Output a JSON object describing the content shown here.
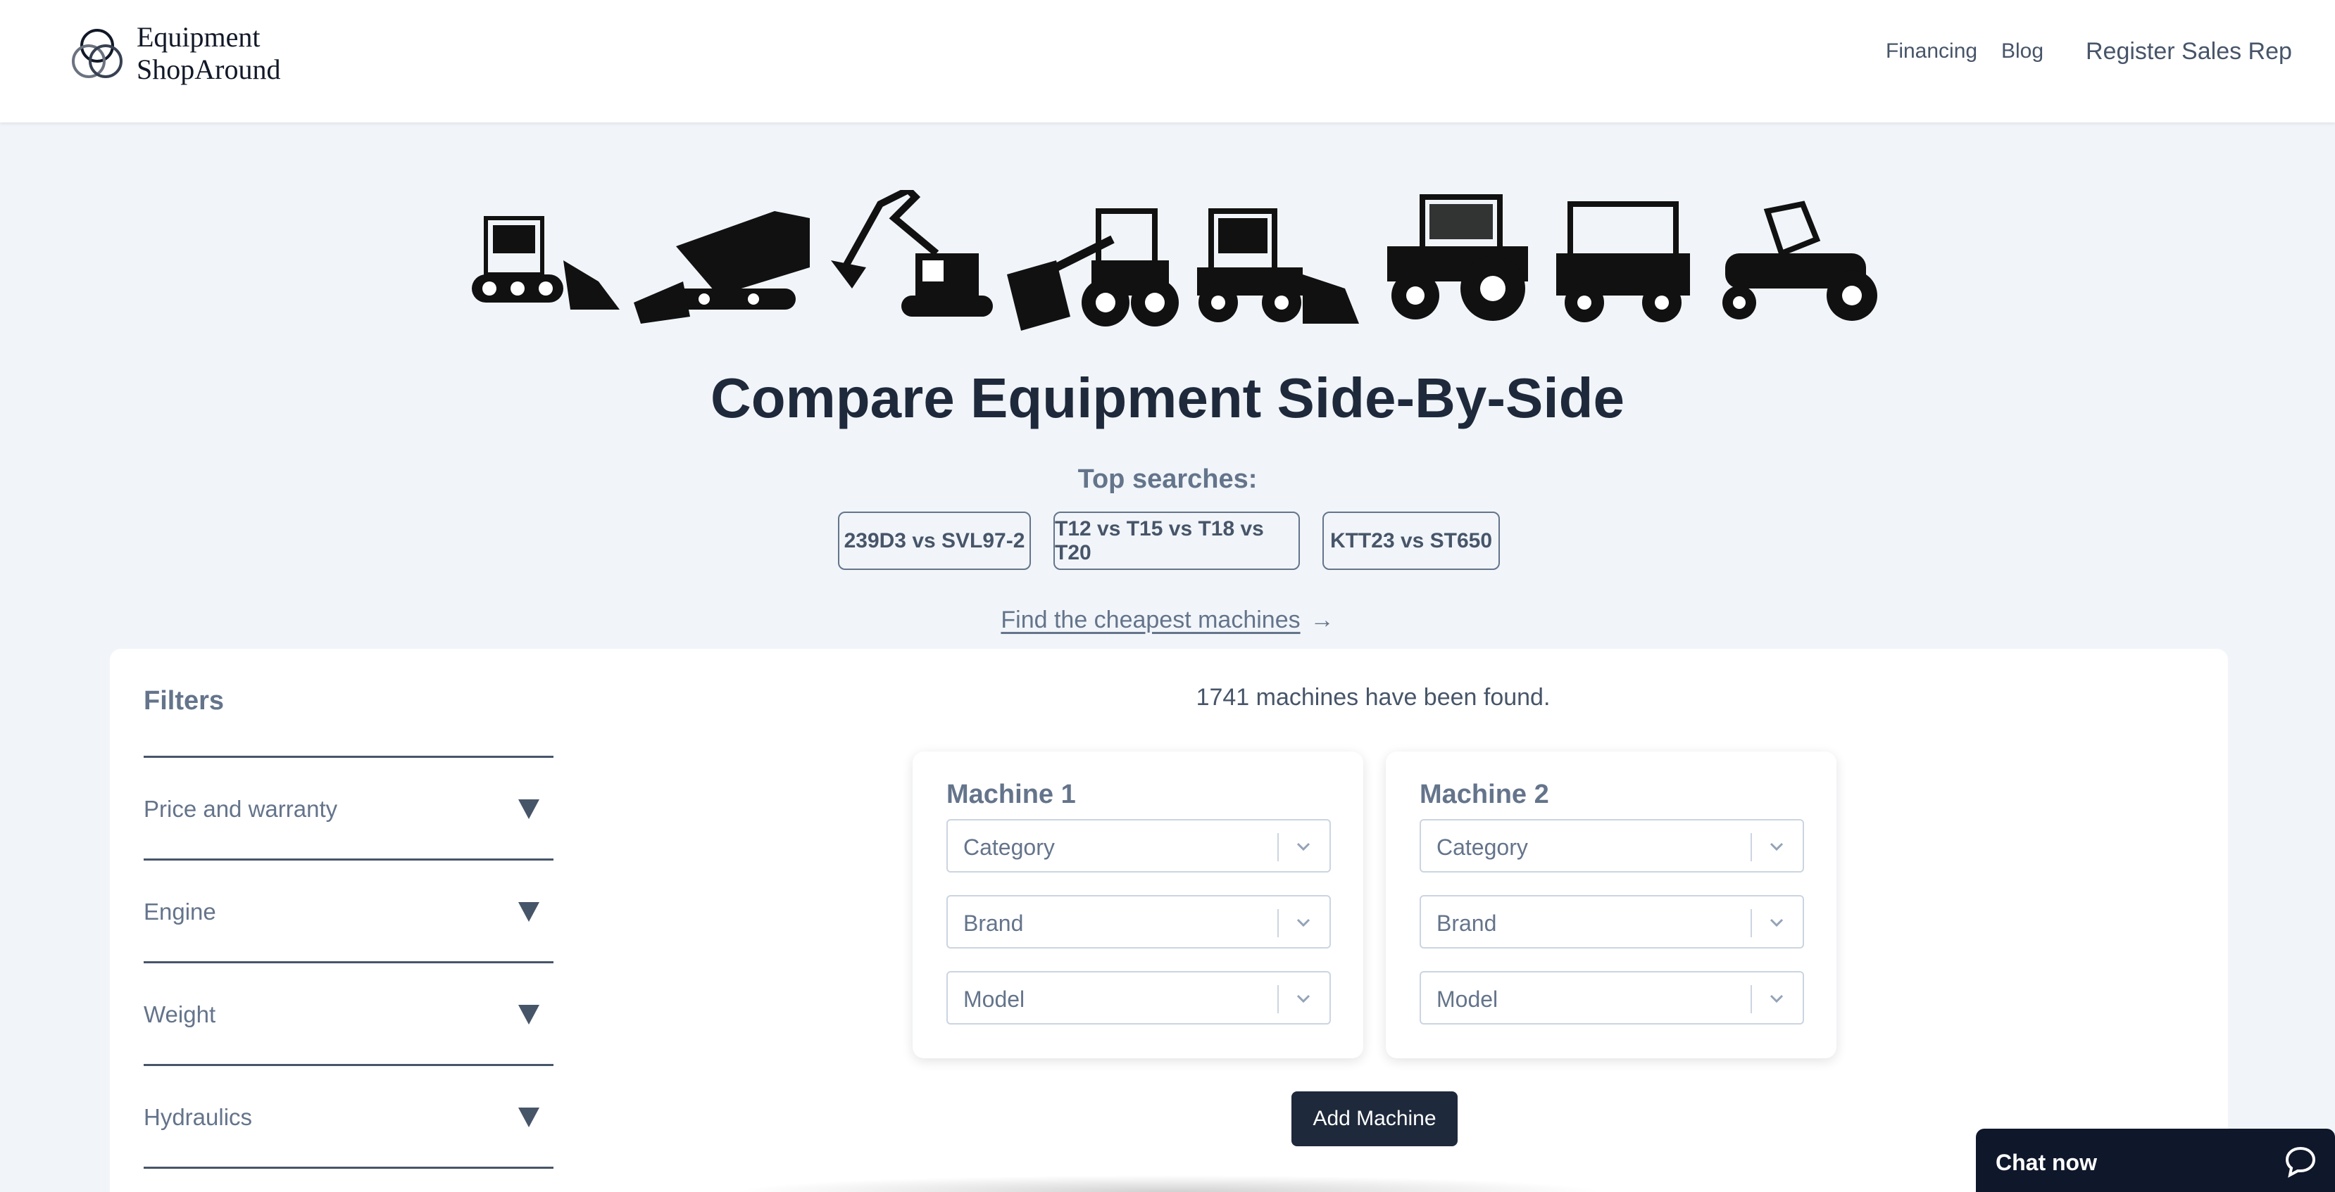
{
  "brand": {
    "line1": "Equipment",
    "line2": "ShopAround"
  },
  "nav": {
    "financing": "Financing",
    "blog": "Blog",
    "register": "Register Sales Rep"
  },
  "hero_icons": [
    "compact-track-loader-icon",
    "mini-skid-steer-icon",
    "excavator-icon",
    "wheel-loader-icon",
    "skid-steer-loader-icon",
    "tractor-icon",
    "utility-vehicle-icon",
    "zero-turn-mower-icon"
  ],
  "title": "Compare Equipment Side-By-Side",
  "top_searches": {
    "label": "Top searches:",
    "items": [
      "239D3 vs SVL97-2",
      "T12 vs T15 vs T18 vs T20",
      "KTT23 vs ST650"
    ]
  },
  "cheapest_link": {
    "label": "Find the cheapest machines",
    "arrow": "→"
  },
  "filters": {
    "title": "Filters",
    "sections": [
      "Price and warranty",
      "Engine",
      "Weight",
      "Hydraulics"
    ]
  },
  "results_count": "1741 machines have been found.",
  "machines": [
    {
      "title": "Machine 1",
      "category_placeholder": "Category",
      "brand_placeholder": "Brand",
      "model_placeholder": "Model"
    },
    {
      "title": "Machine 2",
      "category_placeholder": "Category",
      "brand_placeholder": "Brand",
      "model_placeholder": "Model"
    }
  ],
  "add_machine_label": "Add Machine",
  "chat": {
    "label": "Chat now"
  },
  "colors": {
    "dark": "#1e293b",
    "muted": "#64748b",
    "background": "#f1f5f9",
    "chat": "#0f172a"
  }
}
